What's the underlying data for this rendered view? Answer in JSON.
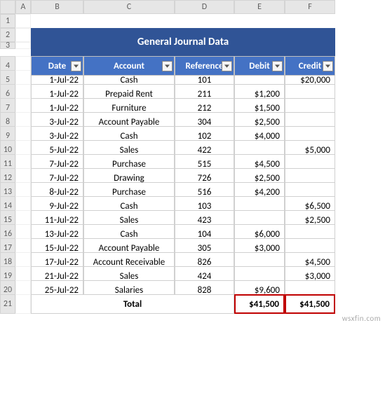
{
  "cols": [
    "A",
    "B",
    "C",
    "D",
    "E",
    "F"
  ],
  "title": "General Journal Data",
  "headers": [
    "Date",
    "Account",
    "Reference",
    "Debit",
    "Credit"
  ],
  "rows": [
    {
      "n": "5",
      "date": "1-Jul-22",
      "acct": "Cash",
      "ref": "101",
      "debit": "",
      "credit": "$20,000"
    },
    {
      "n": "6",
      "date": "1-Jul-22",
      "acct": "Prepaid Rent",
      "ref": "211",
      "debit": "$1,200",
      "credit": ""
    },
    {
      "n": "7",
      "date": "1-Jul-22",
      "acct": "Furniture",
      "ref": "212",
      "debit": "$1,500",
      "credit": ""
    },
    {
      "n": "8",
      "date": "3-Jul-22",
      "acct": "Account Payable",
      "ref": "304",
      "debit": "$2,500",
      "credit": ""
    },
    {
      "n": "9",
      "date": "3-Jul-22",
      "acct": "Cash",
      "ref": "102",
      "debit": "$4,000",
      "credit": ""
    },
    {
      "n": "10",
      "date": "5-Jul-22",
      "acct": "Sales",
      "ref": "422",
      "debit": "",
      "credit": "$5,000"
    },
    {
      "n": "11",
      "date": "7-Jul-22",
      "acct": "Purchase",
      "ref": "515",
      "debit": "$4,500",
      "credit": ""
    },
    {
      "n": "12",
      "date": "7-Jul-22",
      "acct": "Drawing",
      "ref": "726",
      "debit": "$2,500",
      "credit": ""
    },
    {
      "n": "13",
      "date": "8-Jul-22",
      "acct": "Purchase",
      "ref": "516",
      "debit": "$4,200",
      "credit": ""
    },
    {
      "n": "14",
      "date": "9-Jul-22",
      "acct": "Cash",
      "ref": "103",
      "debit": "",
      "credit": "$6,500"
    },
    {
      "n": "15",
      "date": "11-Jul-22",
      "acct": "Sales",
      "ref": "423",
      "debit": "",
      "credit": "$2,500"
    },
    {
      "n": "16",
      "date": "13-Jul-22",
      "acct": "Cash",
      "ref": "104",
      "debit": "$6,000",
      "credit": ""
    },
    {
      "n": "17",
      "date": "15-Jul-22",
      "acct": "Account Payable",
      "ref": "305",
      "debit": "$3,000",
      "credit": ""
    },
    {
      "n": "18",
      "date": "17-Jul-22",
      "acct": "Account Receivable",
      "ref": "826",
      "debit": "",
      "credit": "$4,500"
    },
    {
      "n": "19",
      "date": "21-Jul-22",
      "acct": "Sales",
      "ref": "424",
      "debit": "",
      "credit": "$3,000"
    },
    {
      "n": "20",
      "date": "25-Jul-22",
      "acct": "Salaries",
      "ref": "828",
      "debit": "$9,600",
      "credit": ""
    }
  ],
  "total": {
    "n": "21",
    "label": "Total",
    "debit": "$41,500",
    "credit": "$41,500"
  },
  "watermark": "wsxfin.com",
  "chart_data": {
    "type": "table",
    "title": "General Journal Data",
    "columns": [
      "Date",
      "Account",
      "Reference",
      "Debit",
      "Credit"
    ],
    "data": [
      [
        "1-Jul-22",
        "Cash",
        101,
        null,
        20000
      ],
      [
        "1-Jul-22",
        "Prepaid Rent",
        211,
        1200,
        null
      ],
      [
        "1-Jul-22",
        "Furniture",
        212,
        1500,
        null
      ],
      [
        "3-Jul-22",
        "Account Payable",
        304,
        2500,
        null
      ],
      [
        "3-Jul-22",
        "Cash",
        102,
        4000,
        null
      ],
      [
        "5-Jul-22",
        "Sales",
        422,
        null,
        5000
      ],
      [
        "7-Jul-22",
        "Purchase",
        515,
        4500,
        null
      ],
      [
        "7-Jul-22",
        "Drawing",
        726,
        2500,
        null
      ],
      [
        "8-Jul-22",
        "Purchase",
        516,
        4200,
        null
      ],
      [
        "9-Jul-22",
        "Cash",
        103,
        null,
        6500
      ],
      [
        "11-Jul-22",
        "Sales",
        423,
        null,
        2500
      ],
      [
        "13-Jul-22",
        "Cash",
        104,
        6000,
        null
      ],
      [
        "15-Jul-22",
        "Account Payable",
        305,
        3000,
        null
      ],
      [
        "17-Jul-22",
        "Account Receivable",
        826,
        null,
        4500
      ],
      [
        "21-Jul-22",
        "Sales",
        424,
        null,
        3000
      ],
      [
        "25-Jul-22",
        "Salaries",
        828,
        9600,
        null
      ]
    ],
    "totals": {
      "debit": 41500,
      "credit": 41500
    }
  }
}
